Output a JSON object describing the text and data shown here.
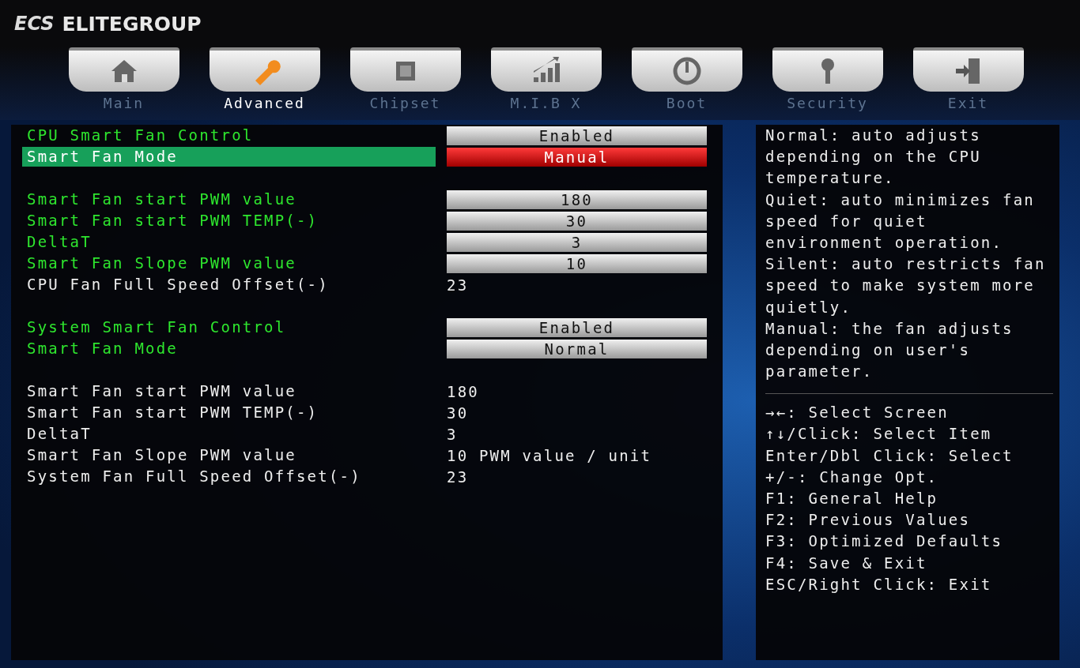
{
  "brand": {
    "logo": "ECS",
    "name": "ELITEGROUP"
  },
  "tabs": [
    {
      "label": "Main",
      "selected": false
    },
    {
      "label": "Advanced",
      "selected": true
    },
    {
      "label": "Chipset",
      "selected": false
    },
    {
      "label": "M.I.B X",
      "selected": false
    },
    {
      "label": "Boot",
      "selected": false
    },
    {
      "label": "Security",
      "selected": false
    },
    {
      "label": "Exit",
      "selected": false
    }
  ],
  "groups": [
    {
      "rows": [
        {
          "label": "CPU Smart Fan Control",
          "value": "Enabled",
          "kind": "option",
          "selected": false
        },
        {
          "label": "Smart Fan Mode",
          "value": "Manual",
          "kind": "option",
          "selected": true
        }
      ]
    },
    {
      "rows": [
        {
          "label": "Smart Fan start PWM value",
          "value": "180",
          "kind": "option",
          "selected": false
        },
        {
          "label": "Smart Fan start PWM TEMP(-)",
          "value": "30",
          "kind": "option",
          "selected": false
        },
        {
          "label": "DeltaT",
          "value": "3",
          "kind": "option",
          "selected": false
        },
        {
          "label": "Smart Fan Slope PWM value",
          "value": "10",
          "kind": "option",
          "selected": false
        },
        {
          "label": "CPU Fan Full Speed Offset(-)",
          "value": "23",
          "kind": "info",
          "selected": false
        }
      ]
    },
    {
      "rows": [
        {
          "label": "System Smart Fan Control",
          "value": "Enabled",
          "kind": "option",
          "selected": false
        },
        {
          "label": "Smart Fan Mode",
          "value": "Normal",
          "kind": "option",
          "selected": false
        }
      ]
    },
    {
      "rows": [
        {
          "label": "Smart Fan start PWM value",
          "value": "180",
          "kind": "info",
          "selected": false
        },
        {
          "label": "Smart Fan start PWM TEMP(-)",
          "value": "30",
          "kind": "info",
          "selected": false
        },
        {
          "label": "DeltaT",
          "value": "3",
          "kind": "info",
          "selected": false
        },
        {
          "label": "Smart Fan Slope PWM value",
          "value": "10 PWM value / unit",
          "kind": "info",
          "selected": false
        },
        {
          "label": "System Fan Full Speed Offset(-)",
          "value": "23",
          "kind": "info",
          "selected": false
        }
      ]
    }
  ],
  "help": [
    "Normal: auto adjusts",
    "depending on the CPU",
    "temperature.",
    "Quiet: auto minimizes fan",
    "speed for quiet",
    "environment operation.",
    "Silent: auto restricts fan",
    "speed to make system more",
    "quietly.",
    "Manual: the fan adjusts",
    "depending on user's",
    "parameter."
  ],
  "keys": [
    "→←: Select Screen",
    "↑↓/Click: Select Item",
    "Enter/Dbl Click: Select",
    "+/-: Change Opt.",
    "F1: General Help",
    "F2: Previous Values",
    "F3: Optimized Defaults",
    "F4: Save & Exit",
    "ESC/Right Click: Exit"
  ]
}
